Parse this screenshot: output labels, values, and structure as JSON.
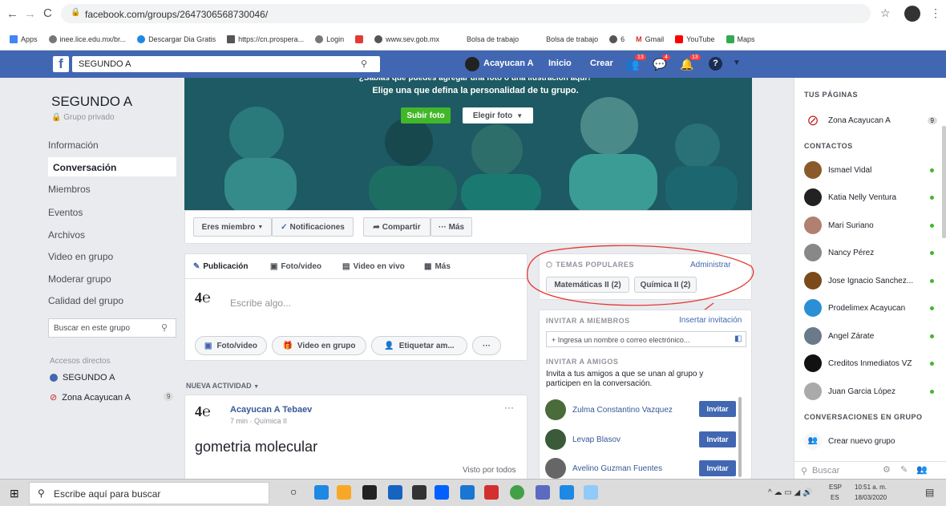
{
  "browser": {
    "url": "facebook.com/groups/264730656873004​6/",
    "bookmarks": [
      "Apps",
      "inee.lice.edu.mx/br...",
      "Descargar Dia Gratis",
      "https://cn.prospera...",
      "Login",
      "",
      "www.sev.gob.mx",
      "Bolsa de trabajo",
      "Bolsa de trabajo",
      "6",
      "Gmail",
      "YouTube",
      "Maps"
    ]
  },
  "fb": {
    "search_value": "SEGUNDO A",
    "profile_name": "Acayucan A",
    "nav_home": "Inicio",
    "nav_create": "Crear",
    "badges": [
      "13",
      "4",
      "13"
    ]
  },
  "group": {
    "name": "SEGUNDO A",
    "privacy": "Grupo privado",
    "nav": [
      "Información",
      "Conversación",
      "Miembros",
      "Eventos",
      "Archivos",
      "Video en grupo",
      "Moderar grupo",
      "Calidad del grupo"
    ],
    "search_placeholder": "Buscar en este grupo",
    "shortcuts_title": "Accesos directos",
    "shortcuts": [
      "SEGUNDO A",
      "Zona Acayucan A"
    ],
    "shortcut_badge": "9"
  },
  "cover": {
    "headline": "¿Sabías que puedes agregar una foto o una ilustración aquí?",
    "subline": "Elige una que defina la personalidad de tu grupo.",
    "upload_label": "Subir foto",
    "choose_label": "Elegir foto"
  },
  "actions": {
    "member": "Eres miembro",
    "notifications": "Notificaciones",
    "share": "Compartir",
    "more": "··· Más"
  },
  "composer": {
    "tabs": [
      "Publicación",
      "Foto/video",
      "Video en vivo",
      "Más"
    ],
    "placeholder": "Escribe algo...",
    "buttons": [
      "Foto/video",
      "Video en grupo",
      "Etiquetar am...",
      "···"
    ]
  },
  "feed": {
    "section_label": "NUEVA ACTIVIDAD",
    "post": {
      "author": "Acayucan A Tebaev",
      "meta": "7 min · Química II",
      "text": "gometria molecular",
      "visibility": "Visto por todos"
    }
  },
  "topics": {
    "title": "TEMAS POPULARES",
    "admin": "Administrar",
    "items": [
      "Matemáticas II (2)",
      "Química II (2)"
    ]
  },
  "invite": {
    "title": "INVITAR A MIEMBROS",
    "link": "Insertar invitación",
    "input_placeholder": "+ Ingresa un nombre o correo electrónico...",
    "friends_title": "INVITAR A AMIGOS",
    "friends_desc": "Invita a tus amigos a que se unan al grupo y participen en la conversación.",
    "friends": [
      "Zulma Constantino Vazquez",
      "Levap Blasov",
      "Avelino Guzman Fuentes"
    ],
    "button": "Invitar"
  },
  "sidebar": {
    "pages_title": "TUS PÁGINAS",
    "page": "Zona Acayucan A",
    "page_badge": "9",
    "contacts_title": "CONTACTOS",
    "contacts": [
      "Ismael Vidal",
      "Katia Nelly Ventura",
      "Mari Suriano",
      "Nancy Pérez",
      "Jose Ignacio Sanchez...",
      "Prodelimex Acayucan",
      "Angel Zárate",
      "Creditos Inmediatos VZ",
      "Juan Garcia López"
    ],
    "group_chats_title": "CONVERSACIONES EN GRUPO",
    "new_group": "Crear nuevo grupo",
    "search_placeholder": "Buscar"
  },
  "taskbar": {
    "search_placeholder": "Escribe aquí para buscar",
    "lang": "ESP",
    "lang2": "ES",
    "time": "10:51 a. m.",
    "date": "18/03/2020"
  },
  "colors": {
    "fb_blue": "#4267b2",
    "green": "#42b72a",
    "cover": "#1d5a63"
  }
}
